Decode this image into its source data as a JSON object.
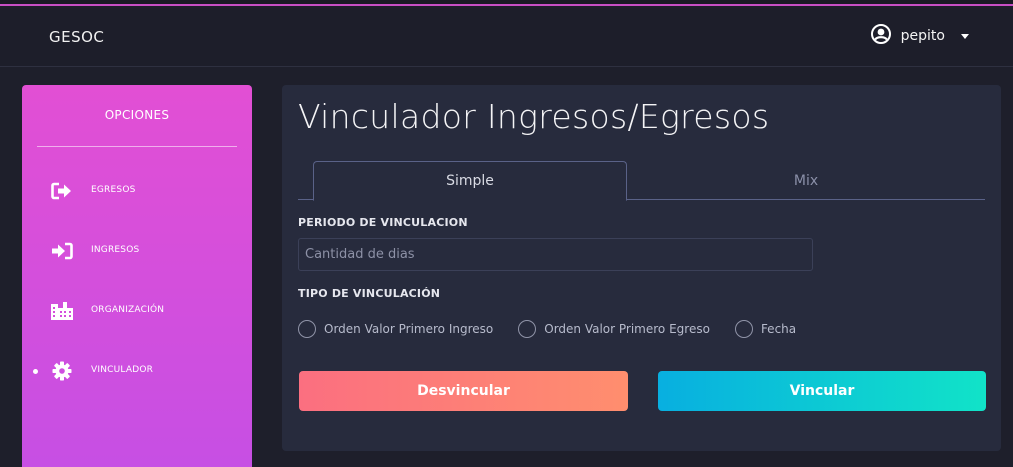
{
  "header": {
    "brand": "GESOC",
    "user_name": "pepito",
    "user_icon": "user-circle-icon"
  },
  "sidebar": {
    "title": "OPCIONES",
    "items": [
      {
        "label": "EGRESOS",
        "icon": "sign-out-icon",
        "active": false
      },
      {
        "label": "INGRESOS",
        "icon": "sign-in-icon",
        "active": false
      },
      {
        "label": "ORGANIZACIÓN",
        "icon": "building-icon",
        "active": false
      },
      {
        "label": "VINCULADOR",
        "icon": "gear-icon",
        "active": true
      }
    ],
    "gradient": [
      "#e24fd4",
      "#c64fe4"
    ]
  },
  "main": {
    "title": "Vinculador Ingresos/Egresos",
    "tabs": [
      {
        "label": "Simple",
        "active": true
      },
      {
        "label": "Mix",
        "active": false
      }
    ],
    "period_label": "PERIODO DE VINCULACION",
    "days_input": {
      "placeholder": "Cantidad de dias",
      "value": ""
    },
    "type_label": "TIPO DE VINCULACIÓN",
    "radio_options": [
      {
        "label": "Orden Valor Primero Ingreso",
        "checked": false
      },
      {
        "label": "Orden Valor Primero Egreso",
        "checked": false
      },
      {
        "label": "Fecha",
        "checked": false
      }
    ],
    "buttons": {
      "unlink": "Desvincular",
      "link": "Vincular"
    }
  },
  "colors": {
    "background": "#1e1f2b",
    "card": "#272b3d",
    "accent_pink": "#e24fd4",
    "unlink_gradient": [
      "#fb6f80",
      "#ff8e6e"
    ],
    "link_gradient": [
      "#08afe0",
      "#11e3c8"
    ]
  }
}
